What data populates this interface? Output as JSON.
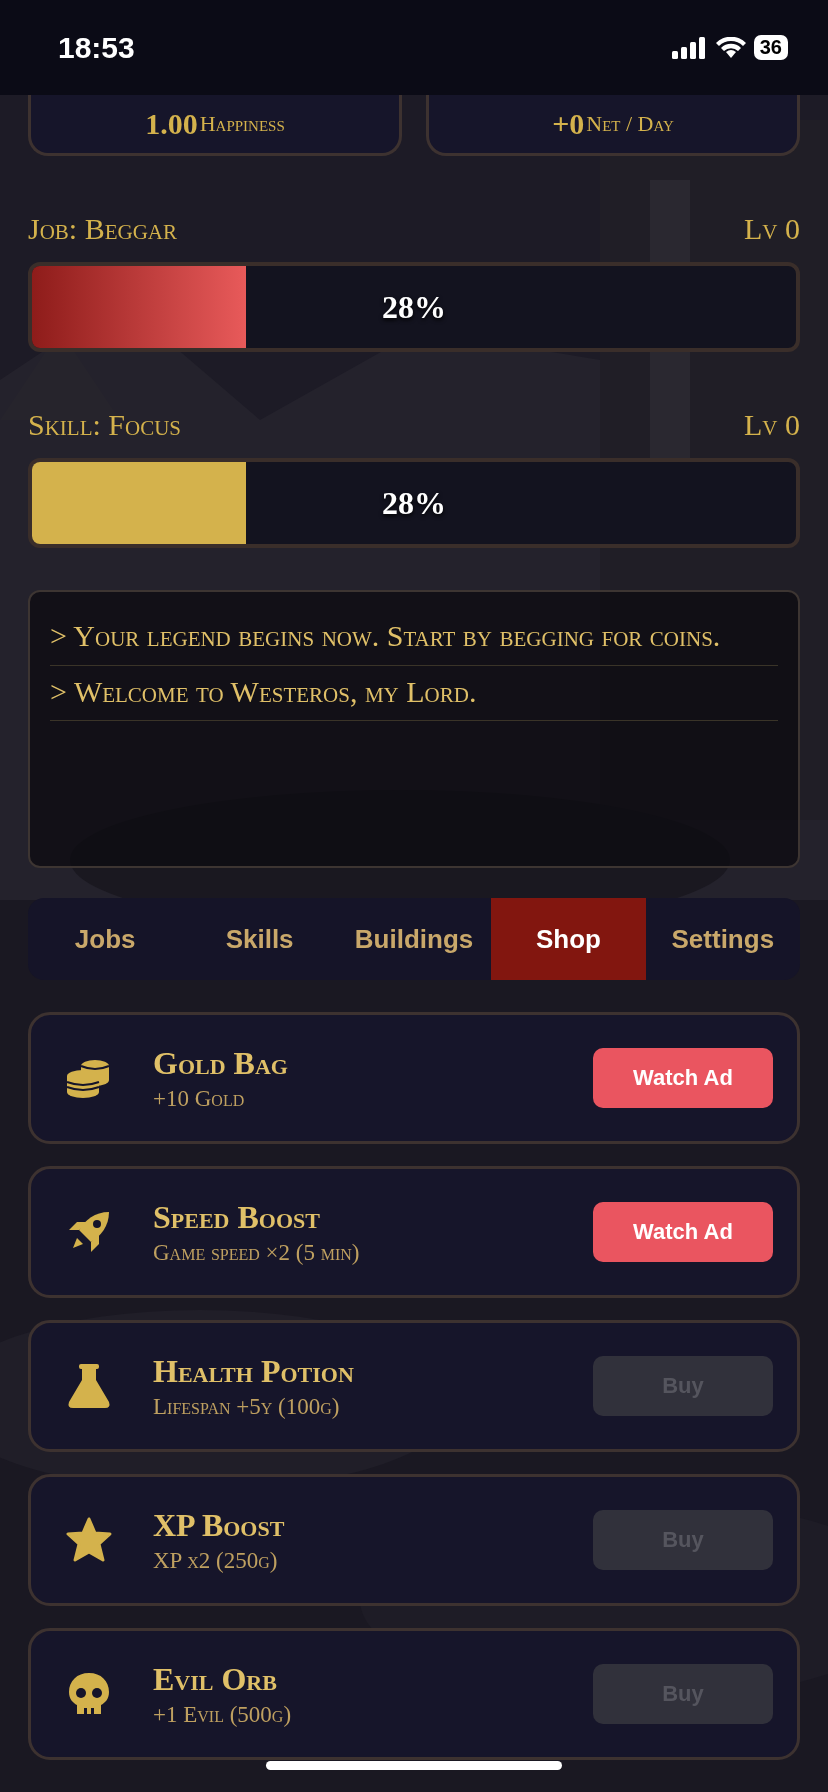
{
  "status_bar": {
    "time": "18:53",
    "battery": "36"
  },
  "stats": [
    {
      "value": "1.00",
      "label": "Happiness"
    },
    {
      "value": "+0",
      "label": "Net / Day"
    }
  ],
  "progress": [
    {
      "kind": "job",
      "label": "Job: Beggar",
      "level_text": "Lv 0",
      "level": 0.28,
      "percent": "28%"
    },
    {
      "kind": "skill",
      "label": "Skill: Focus",
      "level_text": "Lv 0",
      "level": 0.28,
      "percent": "28%"
    }
  ],
  "log": [
    "> Your legend begins now. Start by begging for coins.",
    "> Welcome to Westeros, my Lord."
  ],
  "tabs": [
    {
      "label": "Jobs",
      "selected": false
    },
    {
      "label": "Skills",
      "selected": false
    },
    {
      "label": "Buildings",
      "selected": false
    },
    {
      "label": "Shop",
      "selected": true
    },
    {
      "label": "Settings",
      "selected": false
    }
  ],
  "shop": [
    {
      "name": "Gold Bag",
      "desc": "+10 Gold",
      "button": "Watch Ad",
      "kind": "ad",
      "disabled": false
    },
    {
      "name": "Speed Boost",
      "desc": "Game speed ×2 (5 min)",
      "button": "Watch Ad",
      "kind": "ad",
      "disabled": false
    },
    {
      "name": "Health Potion",
      "desc": "Lifespan +5y (100g)",
      "button": "Buy",
      "kind": "buy",
      "disabled": true
    },
    {
      "name": "XP Boost",
      "desc": "XP x2 (250g)",
      "button": "Buy",
      "kind": "buy",
      "disabled": true
    },
    {
      "name": "Evil Orb",
      "desc": "+1 Evil (500g)",
      "button": "Buy",
      "kind": "buy",
      "disabled": true
    }
  ]
}
